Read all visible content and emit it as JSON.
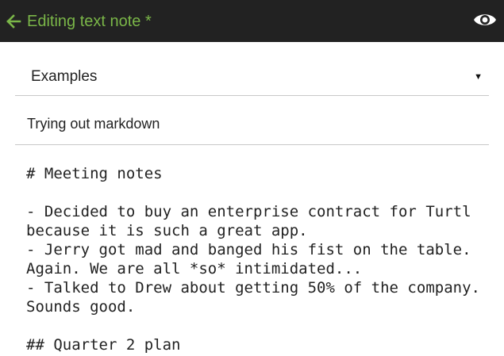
{
  "colors": {
    "accent": "#7ab648",
    "header_bg": "#222222",
    "eye_icon": "#ffffff"
  },
  "header": {
    "title": "Editing text note *",
    "back_icon": "arrow-left-icon",
    "preview_icon": "eye-icon"
  },
  "form": {
    "board": {
      "selected": "Examples",
      "caret": "▼"
    },
    "title": {
      "value": "Trying out markdown"
    },
    "body": {
      "value": "# Meeting notes\n\n- Decided to buy an enterprise contract for Turtl because it is such a great app.\n- Jerry got mad and banged his fist on the table. Again. We are all *so* intimidated...\n- Talked to Drew about getting 50% of the company. Sounds good.\n\n## Quarter 2 plan"
    }
  }
}
